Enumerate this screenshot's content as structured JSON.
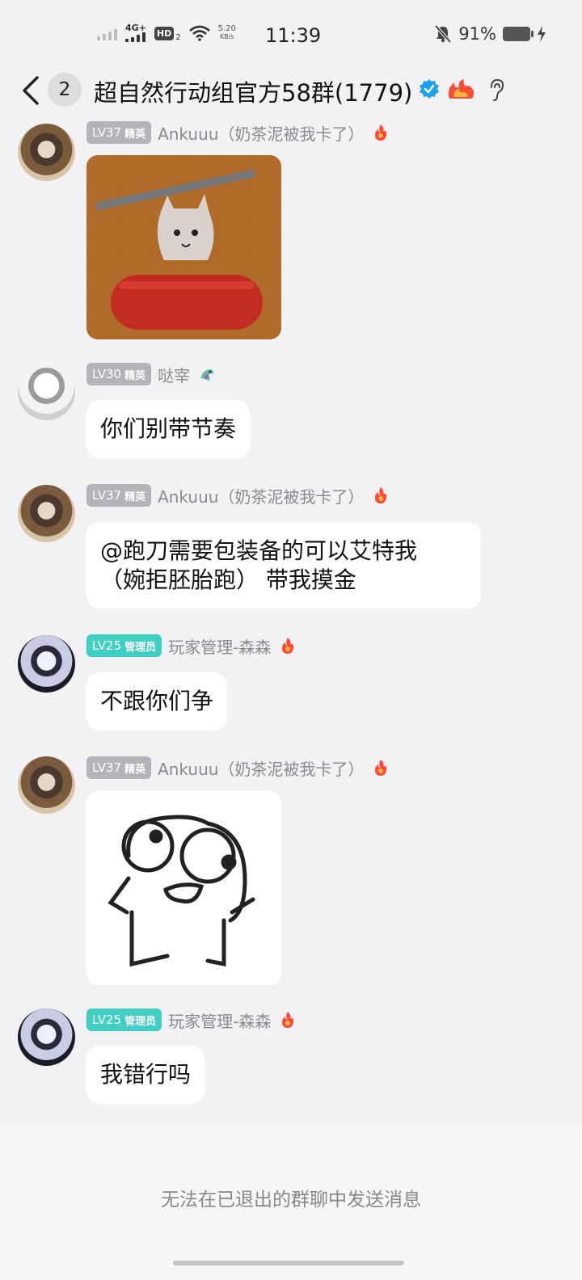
{
  "status_bar": {
    "network_type": "4G+",
    "hd_label": "HD",
    "hd_sub": "2",
    "net_speed_value": "5.20",
    "net_speed_unit": "KB/s",
    "time": "11:39",
    "battery": "91%"
  },
  "header": {
    "unread_count": "2",
    "group_title": "超自然行动组官方58群(1779)"
  },
  "messages": [
    {
      "level": "LV37",
      "role": "精英",
      "nickname": "Ankuuu（奶茶泥被我卡了）",
      "type": "image"
    },
    {
      "level": "LV30",
      "role": "精英",
      "nickname": "哒宰",
      "type": "text",
      "text": "你们别带节奏"
    },
    {
      "level": "LV37",
      "role": "精英",
      "nickname": "Ankuuu（奶茶泥被我卡了）",
      "type": "text",
      "line1": "@跑刀需要包装备的可以艾特我",
      "line2": "（婉拒胚胎跑） 带我摸金"
    },
    {
      "level": "LV25",
      "role": "管理员",
      "nickname": "玩家管理-森森",
      "type": "text",
      "text": "不跟你们争"
    },
    {
      "level": "LV37",
      "role": "精英",
      "nickname": "Ankuuu（奶茶泥被我卡了）",
      "type": "image"
    },
    {
      "level": "LV25",
      "role": "管理员",
      "nickname": "玩家管理-森森",
      "type": "text",
      "text": "我错行吗"
    }
  ],
  "footer": {
    "notice": "无法在已退出的群聊中发送消息"
  },
  "colors": {
    "level_gray": "#b3b3b8",
    "level_teal": "#3fd0c3",
    "verified_blue": "#1aa0f0",
    "flame": "#ff4a3a"
  }
}
